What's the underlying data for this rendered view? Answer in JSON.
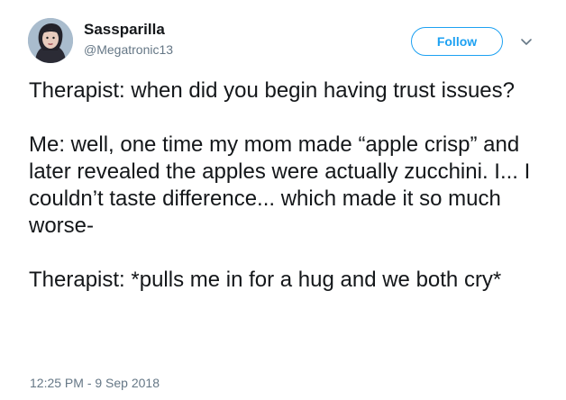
{
  "user": {
    "display_name": "Sassparilla",
    "handle": "@Megatronic13"
  },
  "actions": {
    "follow_label": "Follow"
  },
  "tweet": {
    "paragraphs": [
      "Therapist: when did you begin having trust issues?",
      "Me: well, one time my mom made “apple crisp” and later revealed the apples were actually zucchini. I... I couldn’t taste difference... which made it so much worse-",
      "Therapist: *pulls me in for a hug and we both cry*"
    ],
    "timestamp": "12:25 PM - 9 Sep 2018"
  },
  "colors": {
    "accent": "#1da1f2",
    "text": "#14171a",
    "secondary": "#657786"
  },
  "icons": {
    "more": "chevron-down-icon",
    "avatar": "avatar"
  }
}
